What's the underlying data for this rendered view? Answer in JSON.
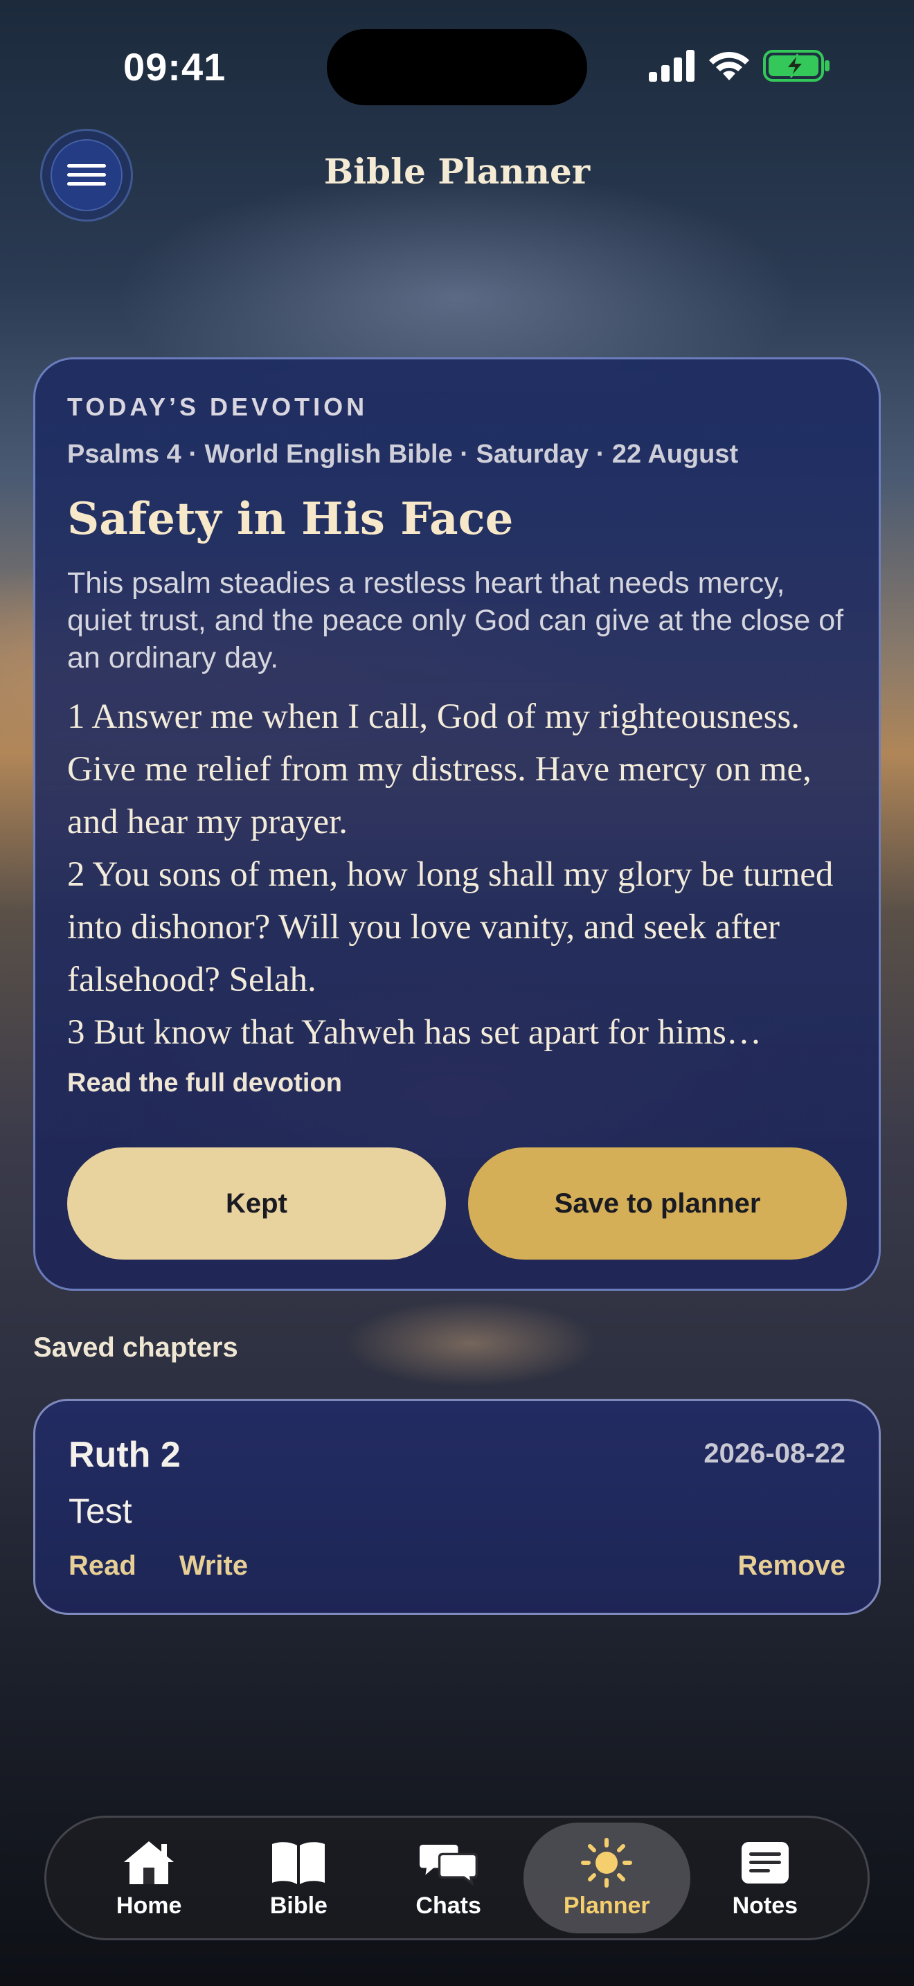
{
  "status_bar": {
    "time": "09:41"
  },
  "header": {
    "title": "Bible Planner"
  },
  "devotion": {
    "eyebrow": "TODAY’S DEVOTION",
    "meta": "Psalms 4 · World English Bible · Saturday · 22 August",
    "title": "Safety in His Face",
    "summary": "This psalm steadies a restless heart that needs mercy, quiet trust, and the peace only God can give at the close of an ordinary day.",
    "verses": [
      "1 Answer me when I call, God of my righteousness. Give me relief from my distress. Have mercy on me, and hear my prayer.",
      "2 You sons of men, how long shall my glory be turned into dishonor? Will you love vanity, and seek after falsehood? Selah.",
      "3 But know that Yahweh has set apart for hims…"
    ],
    "read_full_label": "Read the full devotion",
    "kept_label": "Kept",
    "save_label": "Save to planner"
  },
  "saved": {
    "section_label": "Saved chapters",
    "items": [
      {
        "reference": "Ruth 2",
        "date": "2026-08-22",
        "note": "Test",
        "read_label": "Read",
        "write_label": "Write",
        "remove_label": "Remove"
      }
    ]
  },
  "tabs": [
    {
      "label": "Home",
      "icon": "home-icon",
      "active": false
    },
    {
      "label": "Bible",
      "icon": "book-icon",
      "active": false
    },
    {
      "label": "Chats",
      "icon": "chat-bubbles-icon",
      "active": false
    },
    {
      "label": "Planner",
      "icon": "sun-icon",
      "active": true
    },
    {
      "label": "Notes",
      "icon": "notes-icon",
      "active": false
    }
  ],
  "colors": {
    "accent_gold": "#d4af57",
    "accent_cream": "#e8d29e",
    "card_navy": "#1e2c62",
    "active_tab_label": "#f5cf6e",
    "battery_green": "#34c759"
  }
}
